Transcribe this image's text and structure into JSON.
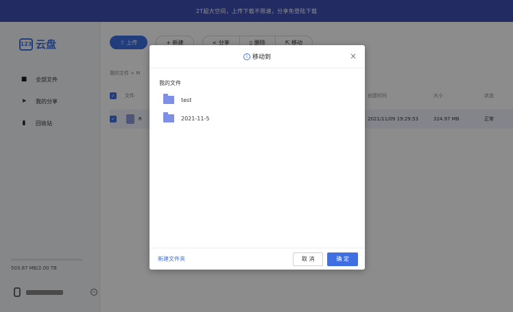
{
  "banner": {
    "text": "2T超大空间，上传下载不限速，分享免登陆下载"
  },
  "sidebar": {
    "logo_badge": "123",
    "logo_text": "云盘",
    "items": [
      {
        "label": "全部文件",
        "icon": "folder-icon"
      },
      {
        "label": "我的分享",
        "icon": "share-icon"
      },
      {
        "label": "回收站",
        "icon": "trash-icon"
      }
    ],
    "storage": {
      "text": "503.87 MB/2.00 TB"
    }
  },
  "toolbar": {
    "upload_label": "上传",
    "new_label": "新建",
    "share_label": "分享",
    "delete_label": "删除",
    "move_label": "移动"
  },
  "breadcrumb": {
    "root": "我的文件",
    "sep": ">",
    "current": "M"
  },
  "table": {
    "headers": {
      "file": "文件",
      "ctime": "创建时间",
      "size": "大小",
      "status": "状态"
    },
    "row": {
      "name": "R",
      "ctime": "2021/11/09 19:29:53",
      "size": "324.97 MB",
      "status": "正常"
    }
  },
  "modal": {
    "title": "移动到",
    "root_label": "我的文件",
    "folders": [
      {
        "name": "test"
      },
      {
        "name": "2021-11-5"
      }
    ],
    "new_folder_label": "新建文件夹",
    "cancel_label": "取 消",
    "ok_label": "确 定"
  },
  "colors": {
    "accent": "#3f6fe0",
    "banner": "#3f51b5",
    "folder": "#7e8fe6"
  }
}
